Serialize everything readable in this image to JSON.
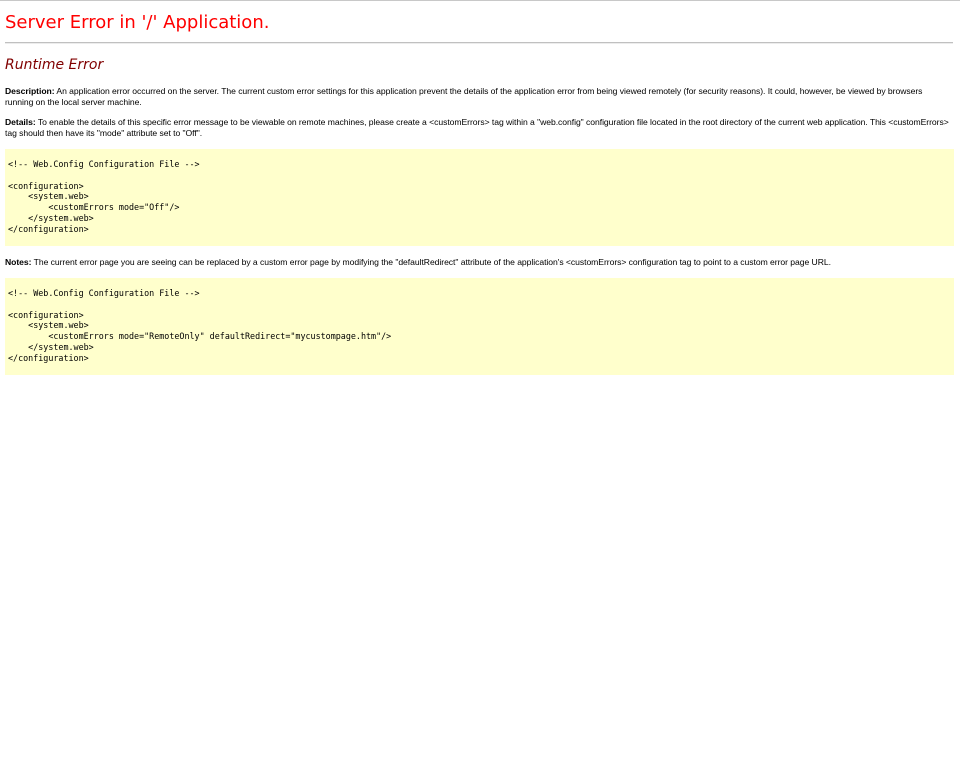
{
  "error_page": {
    "title": "Server Error in '/' Application.",
    "subtitle": "Runtime Error",
    "description_label": "Description:",
    "description_text": " An application error occurred on the server. The current custom error settings for this application prevent the details of the application error from being viewed remotely (for security reasons). It could, however, be viewed by browsers running on the local server machine.",
    "details_label": "Details:",
    "details_text": " To enable the details of this specific error message to be viewable on remote machines, please create a <customErrors> tag within a \"web.config\" configuration file located in the root directory of the current web application. This <customErrors> tag should then have its \"mode\" attribute set to \"Off\".",
    "notes_label": "Notes:",
    "notes_text": " The current error page you are seeing can be replaced by a custom error page by modifying the \"defaultRedirect\" attribute of the application's <customErrors> configuration tag to point to a custom error page URL.",
    "code_block_1": [
      "<!-- Web.Config Configuration File -->",
      "",
      "<configuration>",
      "    <system.web>",
      "        <customErrors mode=\"Off\"/>",
      "    </system.web>",
      "</configuration>"
    ],
    "code_block_2": [
      "<!-- Web.Config Configuration File -->",
      "",
      "<configuration>",
      "    <system.web>",
      "        <customErrors mode=\"RemoteOnly\" defaultRedirect=\"mycustompage.htm\"/>",
      "    </system.web>",
      "</configuration>"
    ]
  },
  "colors": {
    "title": "#ff0000",
    "subtitle": "#800000",
    "code_background": "#ffffcc"
  }
}
